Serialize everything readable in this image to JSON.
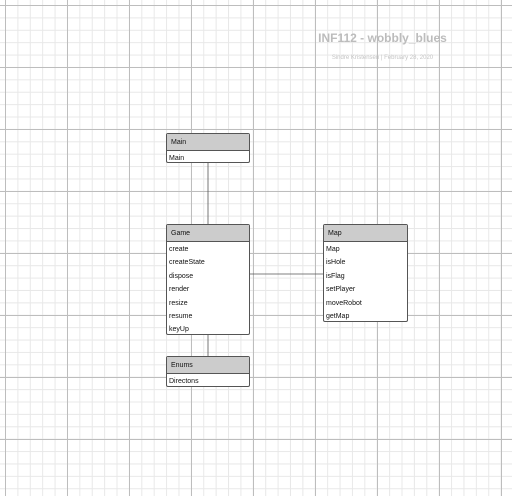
{
  "header": {
    "title": "INF112 - wobbly_blues",
    "author": "Sindre Kristensen",
    "separator": "|",
    "date": "February 28, 2020"
  },
  "classes": {
    "main": {
      "name": "Main",
      "members": [
        "Main"
      ]
    },
    "game": {
      "name": "Game",
      "members": [
        "create",
        "createState",
        "dispose",
        "render",
        "resize",
        "resume",
        "keyUp"
      ]
    },
    "map": {
      "name": "Map",
      "members": [
        "Map",
        "isHole",
        "isFlag",
        "setPlayer",
        "moveRobot",
        "getMap"
      ]
    },
    "enums": {
      "name": "Enums",
      "members": [
        "Directons"
      ]
    }
  },
  "colors": {
    "header_fill": "#cccccc",
    "border": "#555555",
    "connector": "#555555",
    "title_text": "#bcbcbc"
  }
}
